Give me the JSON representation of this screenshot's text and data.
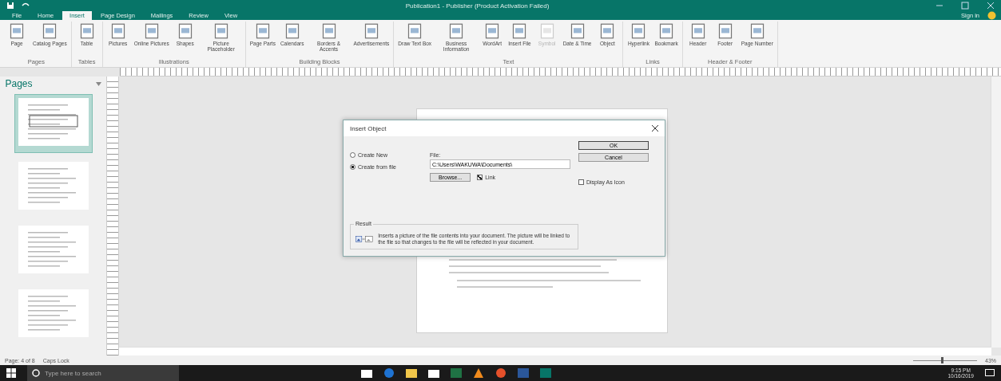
{
  "window": {
    "title": "Publication1 - Publisher (Product Activation Failed)",
    "sign_in": "Sign in"
  },
  "tabs": [
    {
      "label": "File",
      "selected": false
    },
    {
      "label": "Home",
      "selected": false
    },
    {
      "label": "Insert",
      "selected": true
    },
    {
      "label": "Page Design",
      "selected": false
    },
    {
      "label": "Mailings",
      "selected": false
    },
    {
      "label": "Review",
      "selected": false
    },
    {
      "label": "View",
      "selected": false
    }
  ],
  "ribbon_groups": [
    {
      "label": "Pages",
      "items": [
        {
          "label": "Page",
          "disabled": false
        },
        {
          "label": "Catalog Pages",
          "disabled": false
        }
      ]
    },
    {
      "label": "Tables",
      "items": [
        {
          "label": "Table",
          "disabled": false
        }
      ]
    },
    {
      "label": "Illustrations",
      "items": [
        {
          "label": "Pictures",
          "disabled": false
        },
        {
          "label": "Online Pictures",
          "disabled": false
        },
        {
          "label": "Shapes",
          "disabled": false
        },
        {
          "label": "Picture Placeholder",
          "disabled": false
        }
      ]
    },
    {
      "label": "Building Blocks",
      "items": [
        {
          "label": "Page Parts",
          "disabled": false
        },
        {
          "label": "Calendars",
          "disabled": false
        },
        {
          "label": "Borders & Accents",
          "disabled": false
        },
        {
          "label": "Advertisements",
          "disabled": false
        }
      ]
    },
    {
      "label": "Text",
      "items": [
        {
          "label": "Draw Text Box",
          "disabled": false
        },
        {
          "label": "Business Information",
          "disabled": false
        },
        {
          "label": "WordArt",
          "disabled": false
        },
        {
          "label": "Insert File",
          "disabled": false
        },
        {
          "label": "Symbol",
          "disabled": true
        },
        {
          "label": "Date & Time",
          "disabled": false
        },
        {
          "label": "Object",
          "disabled": false
        }
      ]
    },
    {
      "label": "Links",
      "items": [
        {
          "label": "Hyperlink",
          "disabled": false
        },
        {
          "label": "Bookmark",
          "disabled": false
        }
      ]
    },
    {
      "label": "Header & Footer",
      "items": [
        {
          "label": "Header",
          "disabled": false
        },
        {
          "label": "Footer",
          "disabled": false
        },
        {
          "label": "Page Number",
          "disabled": false
        }
      ]
    }
  ],
  "pages_pane": {
    "title": "Pages",
    "pages": [
      {
        "selected": true
      },
      {
        "selected": false
      },
      {
        "selected": false
      },
      {
        "selected": false
      }
    ]
  },
  "dialog": {
    "title": "Insert Object",
    "options": [
      {
        "label": "Create New",
        "selected": false
      },
      {
        "label": "Create from file",
        "selected": true
      }
    ],
    "file_label": "File:",
    "file_value": "C:\\Users\\WAKUWA\\Documents\\",
    "browse": "Browse...",
    "link": {
      "label": "Link",
      "checked": true
    },
    "display_as_icon": {
      "label": "Display As Icon",
      "checked": false
    },
    "ok": "OK",
    "cancel": "Cancel",
    "result_label": "Result",
    "result_text": "Inserts a picture of the file contents into your document.  The picture will be linked to the file so that changes to the file will be reflected in your document."
  },
  "status_bar": {
    "page": "Page: 4 of 8",
    "caps": "Caps Lock",
    "zoom": "43%",
    "zoom_slider": {
      "level": 0.45
    }
  },
  "taskbar": {
    "search_placeholder": "Type here to search",
    "time": "9:15 PM",
    "date": "10/16/2019"
  }
}
